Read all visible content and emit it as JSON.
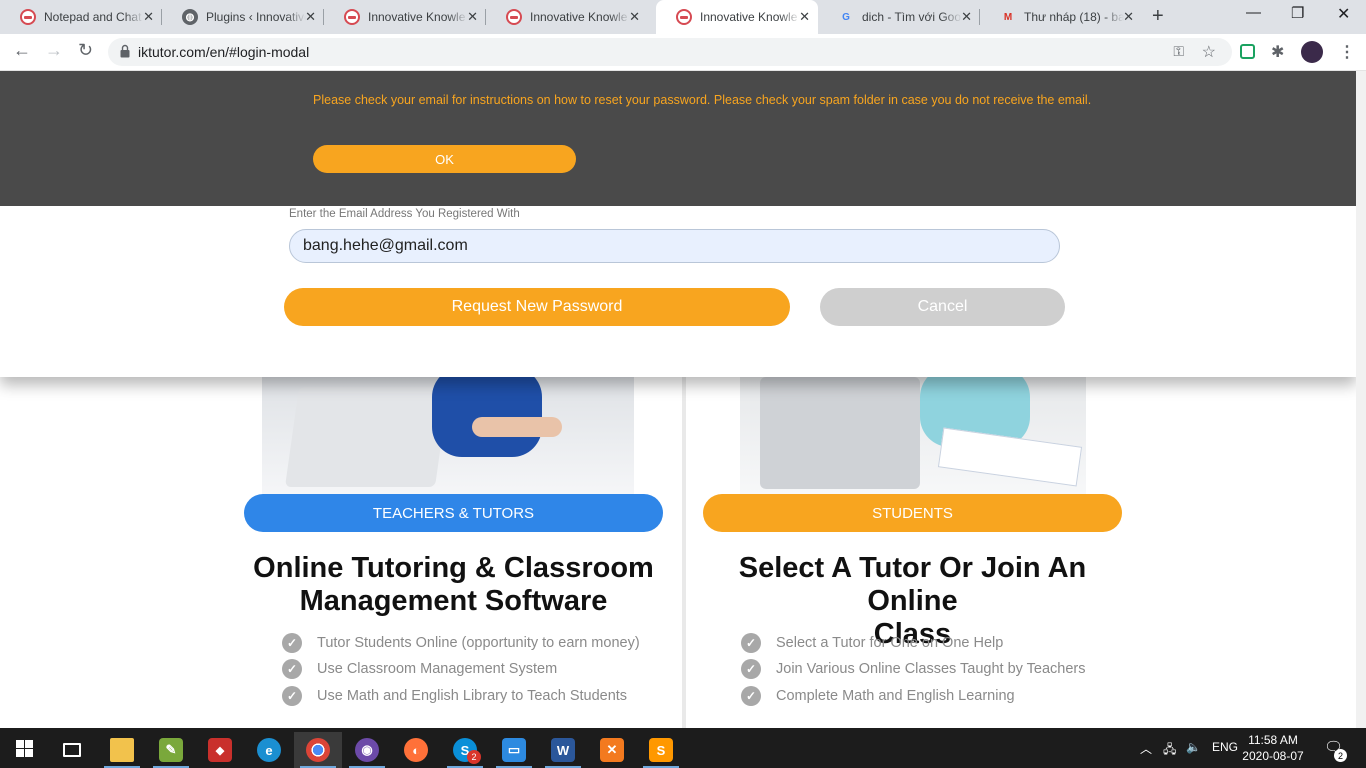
{
  "browser": {
    "tabs": [
      {
        "title": "Notepad and Chat",
        "icon": "innovative-knowledge-favicon"
      },
      {
        "title": "Plugins ‹ Innovative",
        "icon": "wordpress-globe-icon"
      },
      {
        "title": "Innovative Knowle",
        "icon": "innovative-knowledge-favicon"
      },
      {
        "title": "Innovative Knowle",
        "icon": "innovative-knowledge-favicon"
      },
      {
        "title": "Innovative Knowle",
        "icon": "innovative-knowledge-favicon",
        "active": true
      },
      {
        "title": "dich - Tìm với Goo",
        "icon": "google-icon"
      },
      {
        "title": "Thư nháp (18) - ba",
        "icon": "gmail-icon"
      }
    ],
    "url": "iktutor.com/en/#login-modal"
  },
  "alert": {
    "message": "Please check your email for instructions on how to reset your password. Please check your spam folder in case you do not receive the email.",
    "ok_label": "OK"
  },
  "modal": {
    "email_label": "Enter the Email Address You Registered With",
    "email_value": "bang.hehe@gmail.com",
    "request_label": "Request New Password",
    "cancel_label": "Cancel"
  },
  "teachers": {
    "pill": "TEACHERS & TUTORS",
    "heading_line1": "Online Tutoring & Classroom",
    "heading_line2": "Management Software",
    "features": [
      "Tutor Students Online (opportunity to earn money)",
      "Use Classroom Management System",
      "Use Math and English Library to Teach Students"
    ]
  },
  "students": {
    "pill": "STUDENTS",
    "heading_line1": "Select A Tutor Or Join An Online",
    "heading_line2": "Class",
    "features": [
      "Select a Tutor for One on One Help",
      "Join Various Online Classes Taught by Teachers",
      "Complete Math and English Learning"
    ]
  },
  "taskbar": {
    "language": "ENG",
    "time": "11:58 AM",
    "date": "2020-08-07",
    "notification_count": "2",
    "skype_badge": "2"
  },
  "colors": {
    "orange": "#f8a51f",
    "blue": "#2f86e8",
    "alert_bg": "#4a4a4a"
  }
}
